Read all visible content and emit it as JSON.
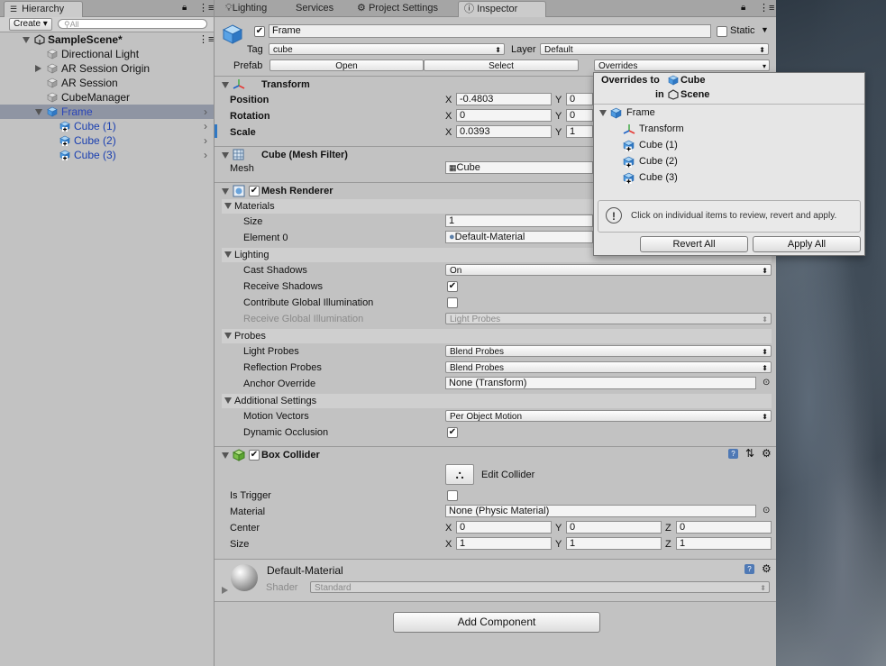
{
  "hierarchy": {
    "tab": "Hierarchy",
    "create_label": "Create",
    "search_placeholder": "All",
    "scene": "SampleScene*",
    "items": [
      {
        "label": "Directional Light"
      },
      {
        "label": "AR Session Origin"
      },
      {
        "label": "AR Session"
      },
      {
        "label": "CubeManager"
      },
      {
        "label": "Frame"
      },
      {
        "label": "Cube (1)"
      },
      {
        "label": "Cube (2)"
      },
      {
        "label": "Cube (3)"
      }
    ]
  },
  "inspector_tabs": [
    "Lighting",
    "Services",
    "Project Settings",
    "Inspector"
  ],
  "object": {
    "name": "Frame",
    "static_label": "Static",
    "tag_label": "Tag",
    "tag_value": "cube",
    "layer_label": "Layer",
    "layer_value": "Default",
    "prefab_label": "Prefab",
    "open_label": "Open",
    "select_label": "Select",
    "overrides_label": "Overrides"
  },
  "transform": {
    "title": "Transform",
    "position_label": "Position",
    "rotation_label": "Rotation",
    "scale_label": "Scale",
    "x_label": "X",
    "y_label": "Y",
    "position_x": "-0.4803",
    "position_y": "0",
    "rotation_x": "0",
    "rotation_y": "0",
    "scale_x": "0.0393",
    "scale_y": "1"
  },
  "mesh_filter": {
    "title": "Cube (Mesh Filter)",
    "mesh_label": "Mesh",
    "mesh_value": "Cube"
  },
  "mesh_renderer": {
    "title": "Mesh Renderer",
    "materials_label": "Materials",
    "size_label": "Size",
    "size_value": "1",
    "element0_label": "Element 0",
    "element0_value": "Default-Material",
    "lighting_label": "Lighting",
    "cast_shadows_label": "Cast Shadows",
    "cast_shadows_value": "On",
    "receive_shadows_label": "Receive Shadows",
    "contribute_gi_label": "Contribute Global Illumination",
    "receive_gi_label": "Receive Global Illumination",
    "receive_gi_value": "Light Probes",
    "probes_label": "Probes",
    "light_probes_label": "Light Probes",
    "light_probes_value": "Blend Probes",
    "reflection_probes_label": "Reflection Probes",
    "reflection_probes_value": "Blend Probes",
    "anchor_override_label": "Anchor Override",
    "anchor_override_value": "None (Transform)",
    "additional_label": "Additional Settings",
    "motion_vectors_label": "Motion Vectors",
    "motion_vectors_value": "Per Object Motion",
    "dynamic_occlusion_label": "Dynamic Occlusion"
  },
  "box_collider": {
    "title": "Box Collider",
    "edit_collider_label": "Edit Collider",
    "is_trigger_label": "Is Trigger",
    "material_label": "Material",
    "material_value": "None (Physic Material)",
    "center_label": "Center",
    "size_label": "Size",
    "x_label": "X",
    "y_label": "Y",
    "z_label": "Z",
    "center_x": "0",
    "center_y": "0",
    "center_z": "0",
    "size_x": "1",
    "size_y": "1",
    "size_z": "1"
  },
  "material": {
    "name": "Default-Material",
    "shader_label": "Shader",
    "shader_value": "Standard"
  },
  "add_component_label": "Add Component",
  "overrides_popup": {
    "title_prefix": "Overrides to",
    "title_target": "Cube",
    "in_label": "in",
    "scene_label": "Scene",
    "tree": [
      {
        "label": "Frame"
      },
      {
        "label": "Transform"
      },
      {
        "label": "Cube (1)"
      },
      {
        "label": "Cube (2)"
      },
      {
        "label": "Cube (3)"
      }
    ],
    "info_text": "Click on individual items to review, revert and apply.",
    "revert_label": "Revert All",
    "apply_label": "Apply All"
  },
  "colors": {
    "selection": "#8f95a3",
    "prefab_blue": "#1a3fb0",
    "panel": "#c2c2c2"
  }
}
